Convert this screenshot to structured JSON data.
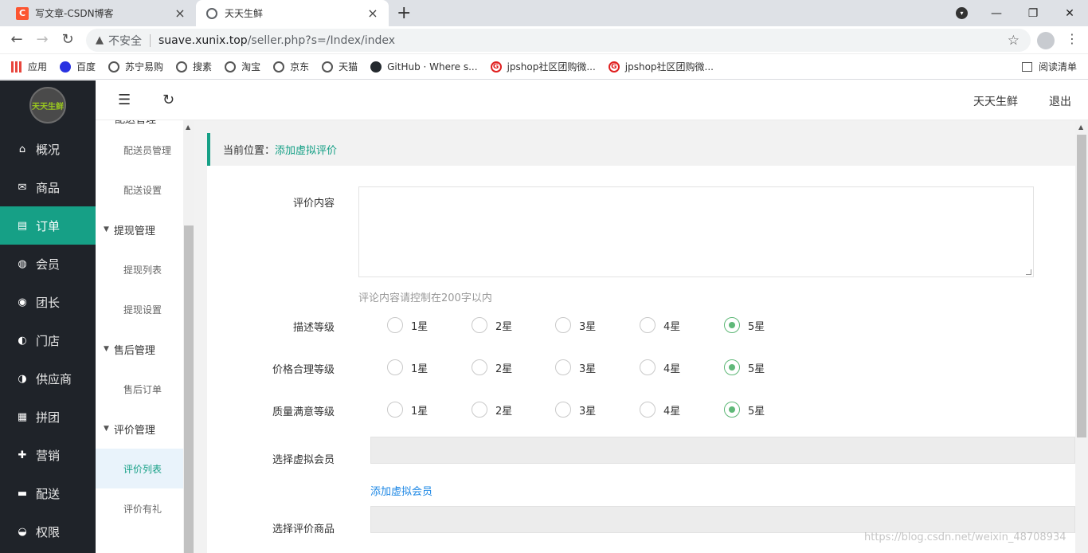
{
  "browser": {
    "tabs": [
      {
        "title": "写文章-CSDN博客",
        "icon": "csdn-icon",
        "active": false
      },
      {
        "title": "天天生鲜",
        "icon": "globe-icon",
        "active": true
      }
    ],
    "new_tab": "+",
    "window_controls": {
      "minimize": "—",
      "restore": "❐",
      "close": "✕"
    },
    "address": {
      "security_label": "不安全",
      "host": "suave.xunix.top",
      "path": "/seller.php?s=/Index/index"
    },
    "bookmarks": [
      {
        "label": "应用",
        "icon": "apps-icon"
      },
      {
        "label": "百度",
        "icon": "baidu-paw-icon"
      },
      {
        "label": "苏宁易购",
        "icon": "globe-icon"
      },
      {
        "label": "搜素",
        "icon": "globe-icon"
      },
      {
        "label": "淘宝",
        "icon": "globe-icon"
      },
      {
        "label": "京东",
        "icon": "globe-icon"
      },
      {
        "label": "天猫",
        "icon": "globe-icon"
      },
      {
        "label": "GitHub · Where s...",
        "icon": "github-icon"
      },
      {
        "label": "jpshop社区团购微...",
        "icon": "jpshop-icon"
      },
      {
        "label": "jpshop社区团购微...",
        "icon": "jpshop-icon"
      }
    ],
    "reading_list": "阅读清单"
  },
  "app": {
    "logo_text": "天天生鲜",
    "header": {
      "shop_name": "天天生鲜",
      "logout": "退出"
    },
    "main_nav": [
      {
        "label": "概况",
        "icon": "home-icon",
        "glyph": "⌂"
      },
      {
        "label": "商品",
        "icon": "goods-icon",
        "glyph": "✉"
      },
      {
        "label": "订单",
        "icon": "order-icon",
        "glyph": "▤",
        "active": true
      },
      {
        "label": "会员",
        "icon": "members-icon",
        "glyph": "◍"
      },
      {
        "label": "团长",
        "icon": "leader-icon",
        "glyph": "◉"
      },
      {
        "label": "门店",
        "icon": "store-icon",
        "glyph": "◐"
      },
      {
        "label": "供应商",
        "icon": "supplier-icon",
        "glyph": "◑"
      },
      {
        "label": "拼团",
        "icon": "group-buy-icon",
        "glyph": "▦"
      },
      {
        "label": "营销",
        "icon": "gift-icon",
        "glyph": "✚"
      },
      {
        "label": "配送",
        "icon": "truck-icon",
        "glyph": "▬"
      },
      {
        "label": "权限",
        "icon": "lock-icon",
        "glyph": "◒"
      }
    ],
    "sub_nav": {
      "cut_group": "配送管理",
      "items": [
        {
          "type": "item",
          "label": "配送员管理"
        },
        {
          "type": "item",
          "label": "配送设置"
        },
        {
          "type": "group",
          "label": "提现管理"
        },
        {
          "type": "item",
          "label": "提现列表"
        },
        {
          "type": "item",
          "label": "提现设置"
        },
        {
          "type": "group",
          "label": "售后管理"
        },
        {
          "type": "item",
          "label": "售后订单"
        },
        {
          "type": "group",
          "label": "评价管理"
        },
        {
          "type": "item",
          "label": "评价列表",
          "active": true
        },
        {
          "type": "item",
          "label": "评价有礼"
        }
      ]
    },
    "breadcrumb": {
      "label": "当前位置：",
      "current": "添加虚拟评价"
    },
    "form": {
      "content_label": "评价内容",
      "content_value": "",
      "content_hint": "评论内容请控制在200字以内",
      "ratings": [
        {
          "label": "描述等级",
          "selected": 5
        },
        {
          "label": "价格合理等级",
          "selected": 5
        },
        {
          "label": "质量满意等级",
          "selected": 5
        }
      ],
      "rating_options": [
        "1星",
        "2星",
        "3星",
        "4星",
        "5星"
      ],
      "member_label": "选择虚拟会员",
      "member_value": "",
      "add_member_link": "添加虚拟会员",
      "product_label": "选择评价商品",
      "product_value": ""
    },
    "accent_color": "#16a086",
    "radio_color": "#5fb878"
  },
  "watermark": "https://blog.csdn.net/weixin_48708934"
}
